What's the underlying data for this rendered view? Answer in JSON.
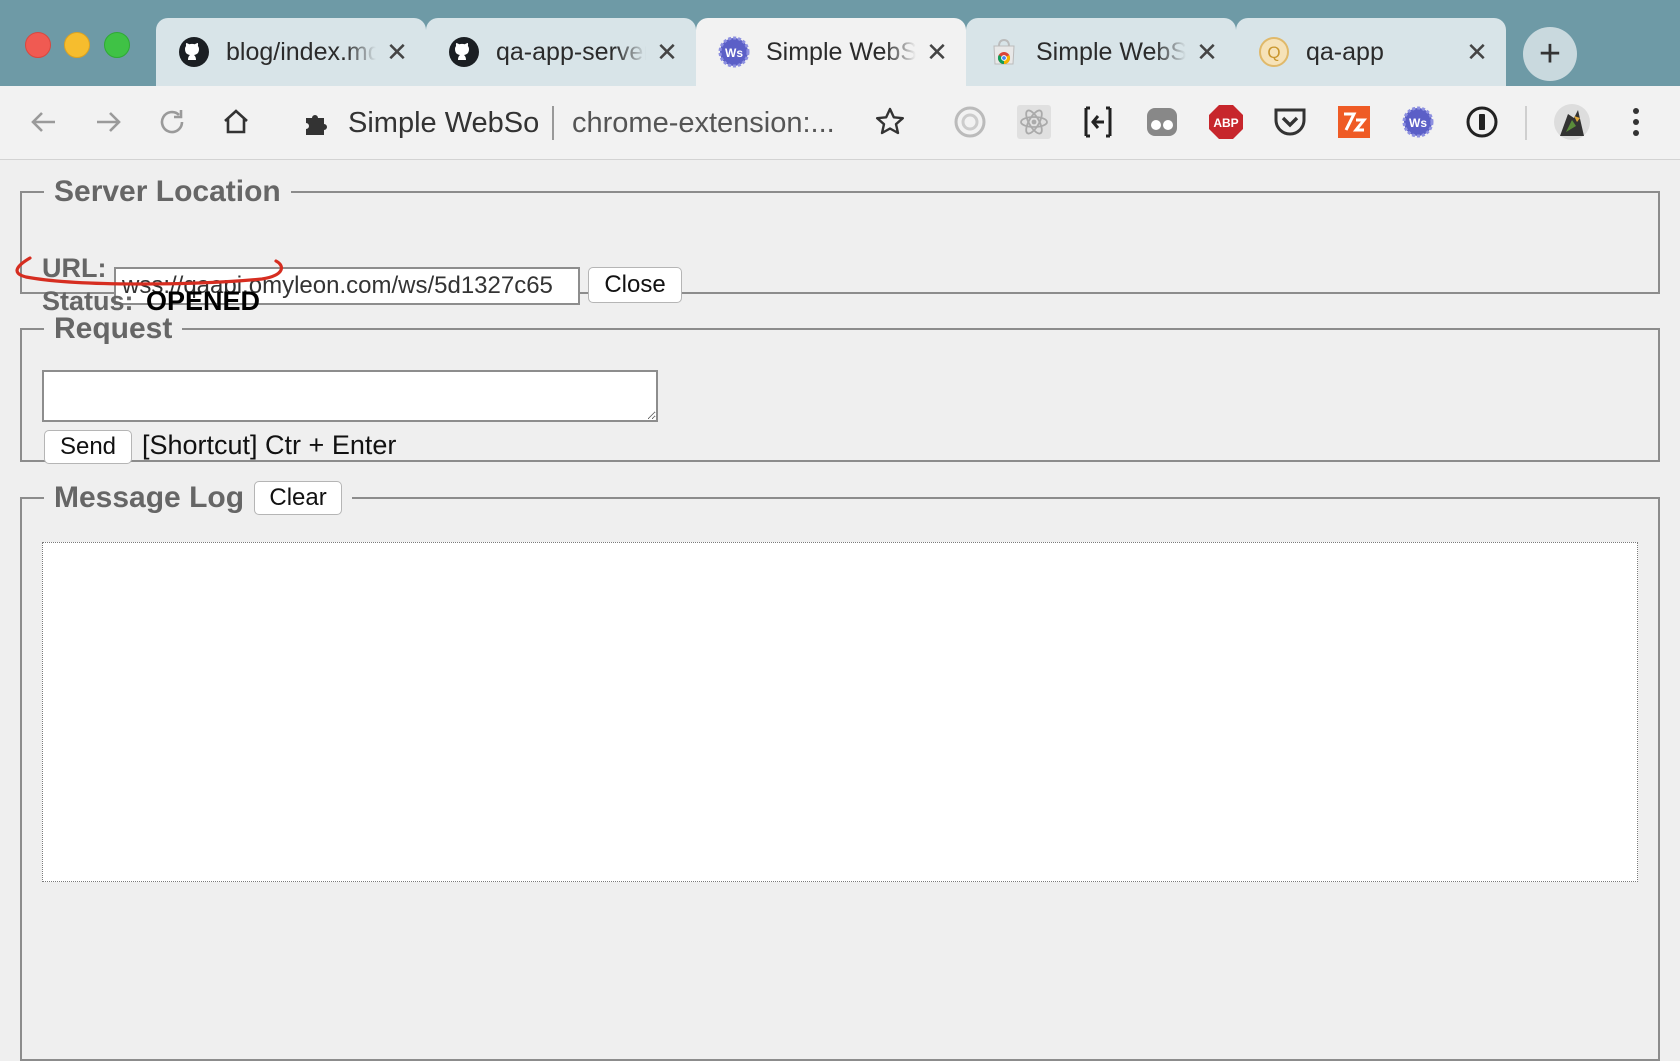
{
  "tabs": [
    {
      "title": "blog/index.md",
      "favicon": "github-icon",
      "active": false
    },
    {
      "title": "qa-app-server",
      "favicon": "github-icon",
      "active": false
    },
    {
      "title": "Simple WebSocket Client",
      "favicon": "websocket-ext-icon",
      "active": true
    },
    {
      "title": "Simple WebSocket Client",
      "favicon": "chrome-webstore-icon",
      "active": false
    },
    {
      "title": "qa-app",
      "favicon": "qa-app-icon",
      "active": false
    }
  ],
  "omnibox": {
    "site_name": "Simple WebSo",
    "url": "chrome-extension:..."
  },
  "extensions": [
    "circle-ext-icon",
    "react-devtools-icon",
    "bracket-ext-icon",
    "ghost-ext-icon",
    "adblock-plus-icon",
    "pocket-icon",
    "postman-ext-icon",
    "websocket-ext-icon",
    "onepassword-icon"
  ],
  "server_location": {
    "legend": "Server Location",
    "url_label": "URL:",
    "url_value": "wss://qaapi.omyleon.com/ws/5d1327c65",
    "close_button": "Close",
    "status_label": "Status:",
    "status_value": "OPENED"
  },
  "request": {
    "legend": "Request",
    "textarea_value": "",
    "send_button": "Send",
    "shortcut_hint": "[Shortcut] Ctr + Enter"
  },
  "message_log": {
    "legend": "Message Log",
    "clear_button": "Clear"
  },
  "colors": {
    "tabbar": "#6e9aa6",
    "annotation": "#d62d20"
  }
}
